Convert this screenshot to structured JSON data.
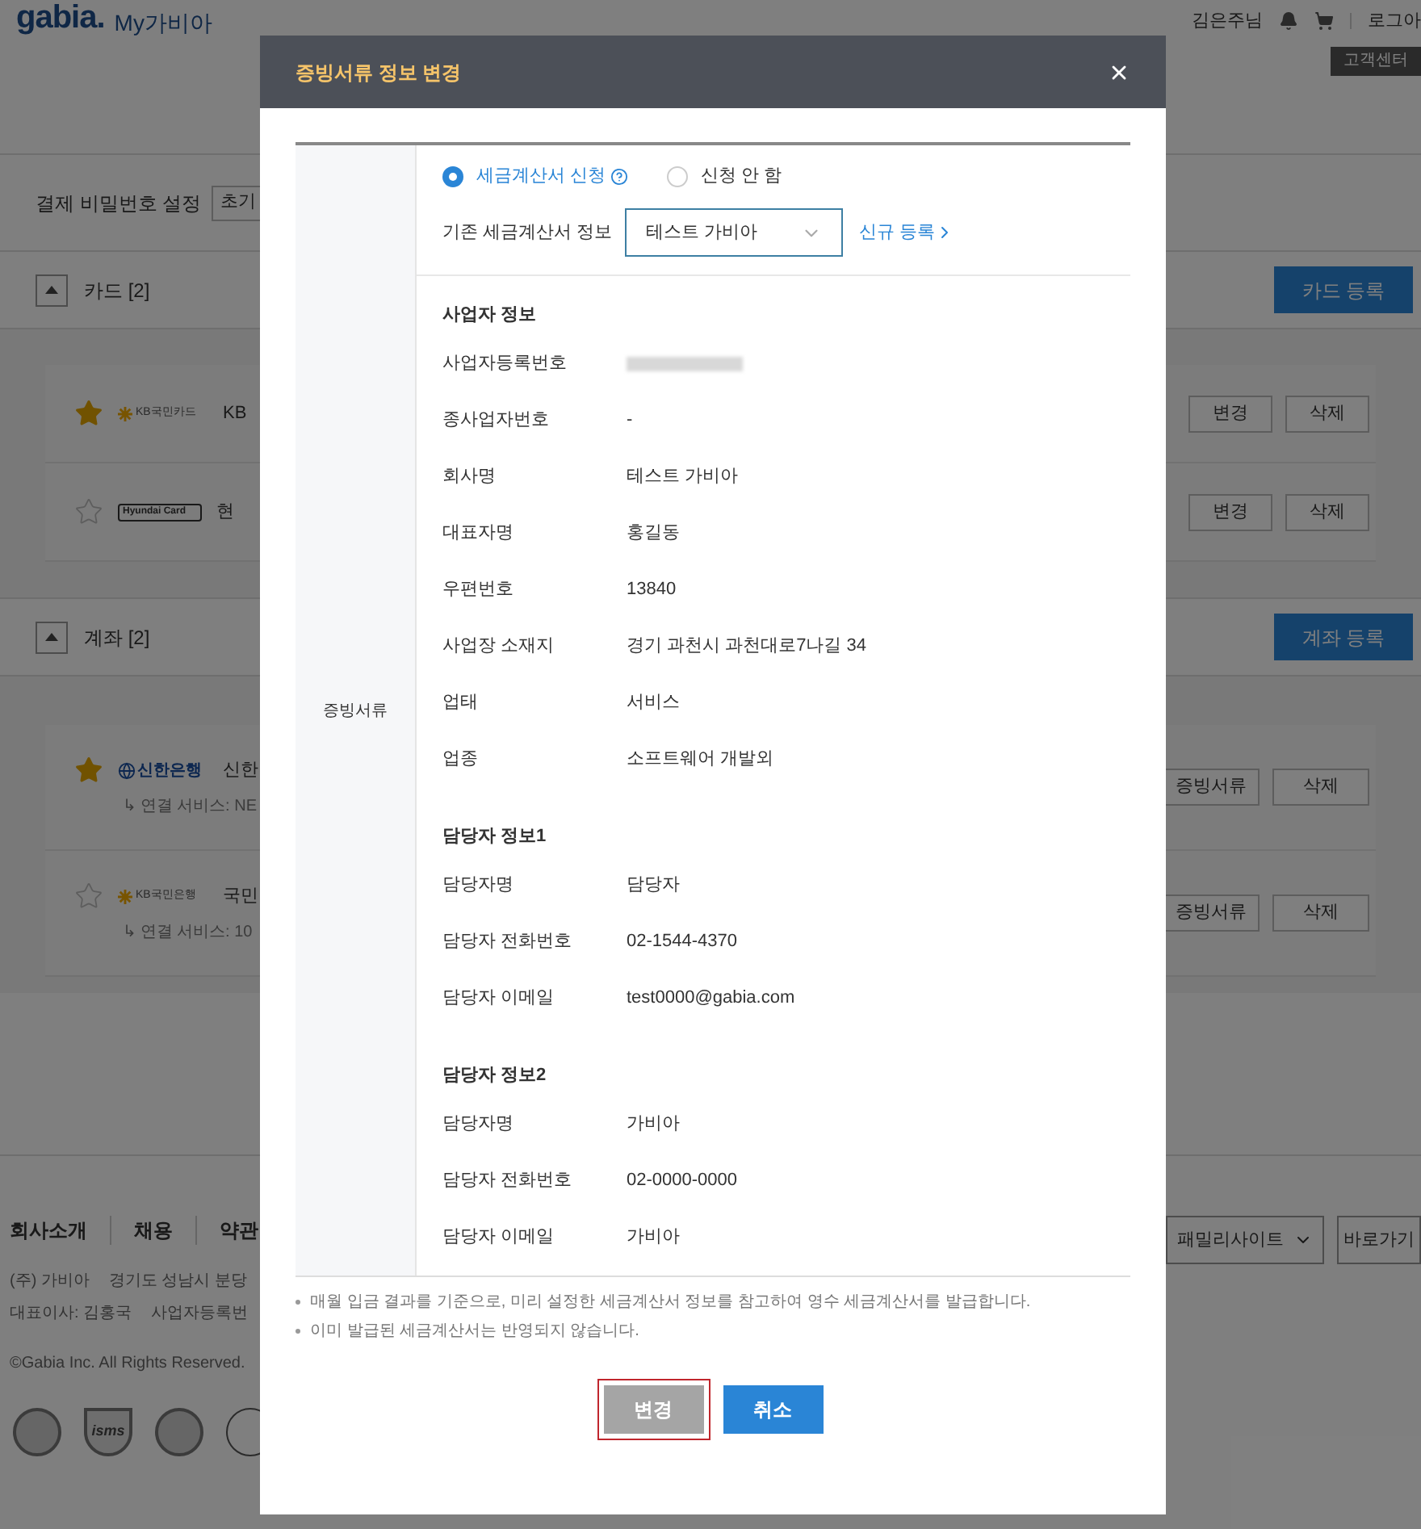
{
  "header": {
    "logo": "gabia.",
    "product": "My가비아",
    "user": "김은주님",
    "logout": "로그아",
    "support": "고객센터"
  },
  "password": {
    "label": "결제 비밀번호 설정",
    "button": "초기"
  },
  "sections": [
    {
      "title": "카드 [2]",
      "expanded": true,
      "register": "카드 등록",
      "items": [
        {
          "favorite": true,
          "kind": "kb",
          "logo": "KB국민카드",
          "name": "KB",
          "buttons": [
            "변경",
            "삭제"
          ]
        },
        {
          "favorite": false,
          "kind": "hyundai",
          "logo": "Hyundai Card",
          "name": "현",
          "buttons": [
            "변경",
            "삭제"
          ]
        }
      ]
    },
    {
      "title": "계좌 [2]",
      "expanded": true,
      "register": "계좌 등록",
      "items": [
        {
          "favorite": true,
          "kind": "shinhan",
          "logo": "신한은행",
          "name": "신한",
          "service": "↳ 연결 서비스: NE",
          "buttons": [
            "증빙서류",
            "삭제"
          ]
        },
        {
          "favorite": false,
          "kind": "kb",
          "logo": "KB국민은행",
          "name": "국민",
          "service": "↳ 연결 서비스: 10",
          "buttons": [
            "증빙서류",
            "삭제"
          ]
        }
      ]
    }
  ],
  "footer": {
    "links": [
      "회사소개",
      "채용",
      "약관"
    ],
    "lines": [
      [
        "(주) 가비아",
        "경기도 성남시 분당"
      ],
      [
        "대표이사: 김홍국",
        "사업자등록번"
      ]
    ],
    "copyright": "©Gabia Inc. All Rights Reserved.",
    "badges": [
      {
        "kind": "seal"
      },
      {
        "kind": "shield",
        "label": "isms"
      },
      {
        "kind": "seal"
      },
      {
        "kind": "globe"
      }
    ],
    "family_site": "패밀리사이트",
    "go": "바로가기"
  },
  "modal": {
    "title": "증빙서류 정보 변경",
    "side_label": "증빙서류",
    "radios": [
      {
        "label": "세금계산서 신청",
        "selected": true,
        "help": true
      },
      {
        "label": "신청 안 함",
        "selected": false,
        "help": false
      }
    ],
    "existing_label": "기존 세금계산서 정보",
    "select_value": "테스트 가비아",
    "new_link": "신규 등록",
    "groups": [
      {
        "title": "사업자 정보",
        "fields": [
          {
            "label": "사업자등록번호",
            "kind": "redacted"
          },
          {
            "label": "종사업자번호",
            "value": "-",
            "kind": "text"
          },
          {
            "label": "회사명",
            "value": "테스트 가비아",
            "kind": "text"
          },
          {
            "label": "대표자명",
            "value": "홍길동",
            "kind": "text"
          },
          {
            "label": "우편번호",
            "value": "13840",
            "kind": "text"
          },
          {
            "label": "사업장 소재지",
            "value": "경기 과천시 과천대로7나길 34",
            "kind": "text"
          },
          {
            "label": "업태",
            "value": "서비스",
            "kind": "text"
          },
          {
            "label": "업종",
            "value": "소프트웨어 개발외",
            "kind": "text"
          }
        ]
      },
      {
        "title": "담당자 정보1",
        "fields": [
          {
            "label": "담당자명",
            "value": "담당자",
            "kind": "text"
          },
          {
            "label": "담당자 전화번호",
            "value": "02-1544-4370",
            "kind": "text"
          },
          {
            "label": "담당자 이메일",
            "value": "test0000@gabia.com",
            "kind": "text"
          }
        ]
      },
      {
        "title": "담당자 정보2",
        "fields": [
          {
            "label": "담당자명",
            "value": "가비아",
            "kind": "text"
          },
          {
            "label": "담당자 전화번호",
            "value": "02-0000-0000",
            "kind": "text"
          },
          {
            "label": "담당자 이메일",
            "value": "가비아",
            "kind": "text"
          }
        ]
      }
    ],
    "notes": [
      "매월 입금 결과를 기준으로, 미리 설정한 세금계산서 정보를 참고하여 영수 세금계산서를 발급합니다.",
      "이미 발급된 세금계산서는 반영되지 않습니다."
    ],
    "buttons": [
      {
        "label": "변경",
        "kind": "disabled",
        "focused": true
      },
      {
        "label": "취소",
        "kind": "primary",
        "focused": false
      }
    ]
  }
}
